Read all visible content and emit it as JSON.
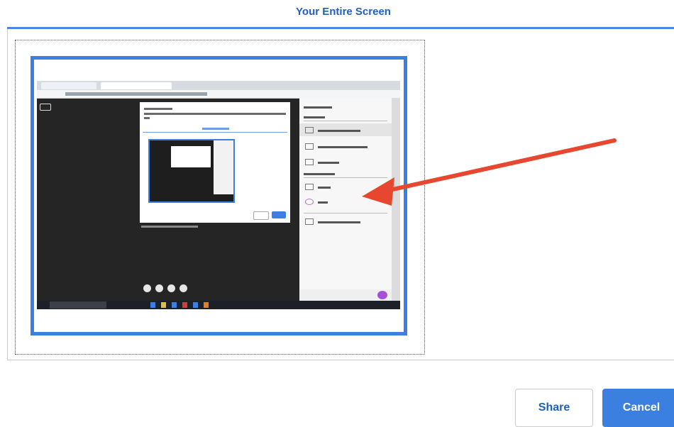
{
  "dialog": {
    "tab_label": "Your Entire Screen",
    "buttons": {
      "share_label": "Share",
      "cancel_label": "Cancel"
    }
  },
  "colors": {
    "accent": "#3b7fe0",
    "title_text": "#1f5fbf",
    "arrow": "#e8472f"
  },
  "icons": {
    "annotation": "arrow-annotation-icon"
  }
}
